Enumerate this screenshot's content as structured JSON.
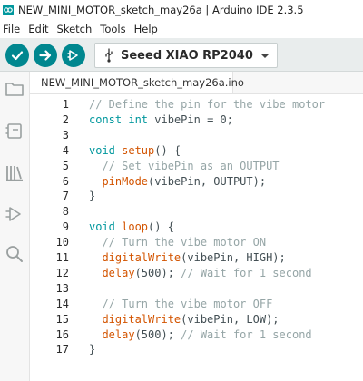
{
  "window": {
    "title": "NEW_MINI_MOTOR_sketch_may26a | Arduino IDE 2.3.5"
  },
  "menu": {
    "items": [
      "File",
      "Edit",
      "Sketch",
      "Tools",
      "Help"
    ]
  },
  "toolbar": {
    "verify_icon": "check-icon",
    "upload_icon": "arrow-right-icon",
    "debug_icon": "debug-icon",
    "board_name": "Seeed XIAO RP2040",
    "board_icon": "usb-icon",
    "accent_color": "#00878f"
  },
  "sidebar": {
    "items": [
      "folder-icon",
      "board-manager-icon",
      "library-icon",
      "debug-icon",
      "search-icon"
    ]
  },
  "tab": {
    "filename": "NEW_MINI_MOTOR_sketch_may26a.ino"
  },
  "code": {
    "line_numbers": [
      "1",
      "2",
      "3",
      "4",
      "5",
      "6",
      "7",
      "8",
      "9",
      "10",
      "11",
      "12",
      "13",
      "14",
      "15",
      "16",
      "17"
    ],
    "lines": [
      [
        {
          "t": "// Define the pin for the vibe motor",
          "c": "comment"
        }
      ],
      [
        {
          "t": "const ",
          "c": "type"
        },
        {
          "t": "int ",
          "c": "type"
        },
        {
          "t": "vibePin = 0;",
          "c": "plain"
        }
      ],
      [],
      [
        {
          "t": "void ",
          "c": "type"
        },
        {
          "t": "setup",
          "c": "func"
        },
        {
          "t": "() {",
          "c": "plain"
        }
      ],
      [
        {
          "t": "  // Set vibePin as an OUTPUT",
          "c": "comment"
        }
      ],
      [
        {
          "t": "  ",
          "c": "plain"
        },
        {
          "t": "pinMode",
          "c": "func"
        },
        {
          "t": "(vibePin, OUTPUT);",
          "c": "plain"
        }
      ],
      [
        {
          "t": "}",
          "c": "plain"
        }
      ],
      [],
      [
        {
          "t": "void ",
          "c": "type"
        },
        {
          "t": "loop",
          "c": "func"
        },
        {
          "t": "() {",
          "c": "plain"
        }
      ],
      [
        {
          "t": "  // Turn the vibe motor ON",
          "c": "comment"
        }
      ],
      [
        {
          "t": "  ",
          "c": "plain"
        },
        {
          "t": "digitalWrite",
          "c": "func"
        },
        {
          "t": "(vibePin, HIGH);",
          "c": "plain"
        }
      ],
      [
        {
          "t": "  ",
          "c": "plain"
        },
        {
          "t": "delay",
          "c": "func"
        },
        {
          "t": "(500); ",
          "c": "plain"
        },
        {
          "t": "// Wait for 1 second",
          "c": "comment"
        }
      ],
      [],
      [
        {
          "t": "  // Turn the vibe motor OFF",
          "c": "comment"
        }
      ],
      [
        {
          "t": "  ",
          "c": "plain"
        },
        {
          "t": "digitalWrite",
          "c": "func"
        },
        {
          "t": "(vibePin, LOW);",
          "c": "plain"
        }
      ],
      [
        {
          "t": "  ",
          "c": "plain"
        },
        {
          "t": "delay",
          "c": "func"
        },
        {
          "t": "(500); ",
          "c": "plain"
        },
        {
          "t": "// Wait for 1 second",
          "c": "comment"
        }
      ],
      [
        {
          "t": "}",
          "c": "plain"
        }
      ]
    ]
  }
}
